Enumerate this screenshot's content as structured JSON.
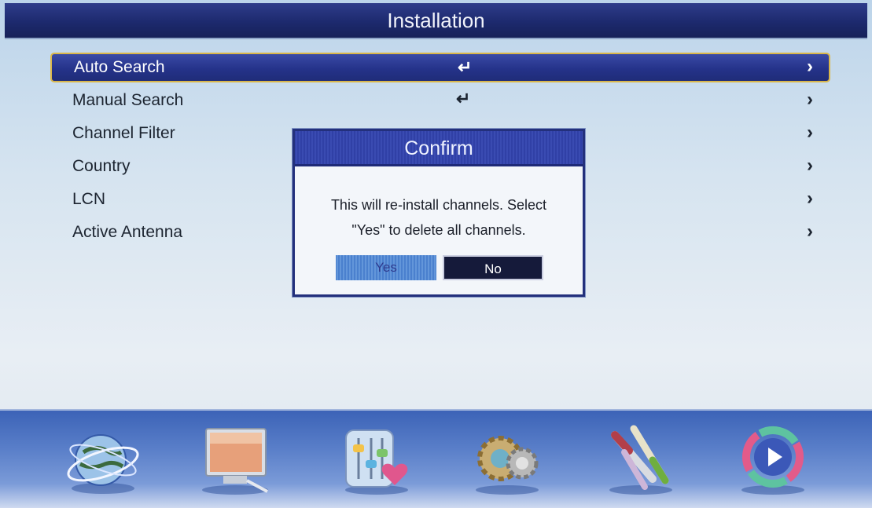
{
  "window": {
    "title": "Installation"
  },
  "menu": {
    "items": [
      {
        "label": "Auto Search",
        "value": "↵",
        "selected": true
      },
      {
        "label": "Manual Search",
        "value": "↵"
      },
      {
        "label": "Channel Filter",
        "value": ""
      },
      {
        "label": "Country",
        "value": ""
      },
      {
        "label": "LCN",
        "value": ""
      },
      {
        "label": "Active Antenna",
        "value": ""
      }
    ],
    "chevron": "›"
  },
  "dialog": {
    "title": "Confirm",
    "message_line1": "This will re-install channels. Select",
    "message_line2": "\"Yes\" to delete all channels.",
    "yes_label": "Yes",
    "no_label": "No"
  },
  "dock": {
    "items": [
      "globe-icon",
      "monitor-icon",
      "equalizer-icon",
      "gear-icon",
      "tools-icon",
      "play-icon"
    ]
  },
  "colors": {
    "title_bar": "#1d2a6e",
    "selection": "#25338a",
    "selection_border": "#d9b64a",
    "dock": "#5a7fc9"
  }
}
